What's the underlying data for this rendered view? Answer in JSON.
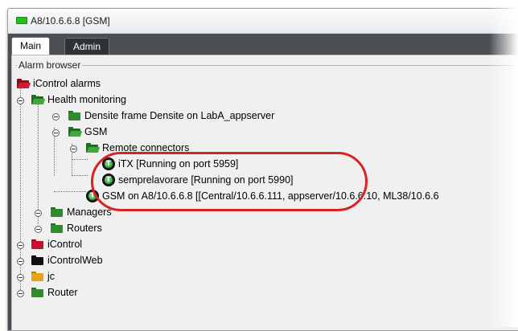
{
  "window": {
    "title": "A8/10.6.6.8 [GSM]"
  },
  "tabs": {
    "main": "Main",
    "admin": "Admin"
  },
  "groupbox": {
    "label": "Alarm browser"
  },
  "tree": {
    "root": "iControl alarms",
    "health": "Health monitoring",
    "densite": "Densite frame Densite on LabA_appserver",
    "gsm": "GSM",
    "remote": "Remote connectors",
    "itx": "iTX [Running on port 5959]",
    "sempre": "semprelavorare [Running on port 5990]",
    "gsm_on": "GSM on A8/10.6.6.8 [[Central/10.6.6.111, appserver/10.6.6.10, ML38/10.6.6",
    "managers": "Managers",
    "routers": "Routers",
    "icontrol": "iControl",
    "icontrolweb": "iControlWeb",
    "jc": "jc",
    "router": "Router"
  },
  "colors": {
    "folder_red": "#c8102e",
    "folder_green": "#2e8b2e",
    "folder_black": "#111111",
    "folder_orange": "#e8a317",
    "highlight": "#d62424"
  }
}
